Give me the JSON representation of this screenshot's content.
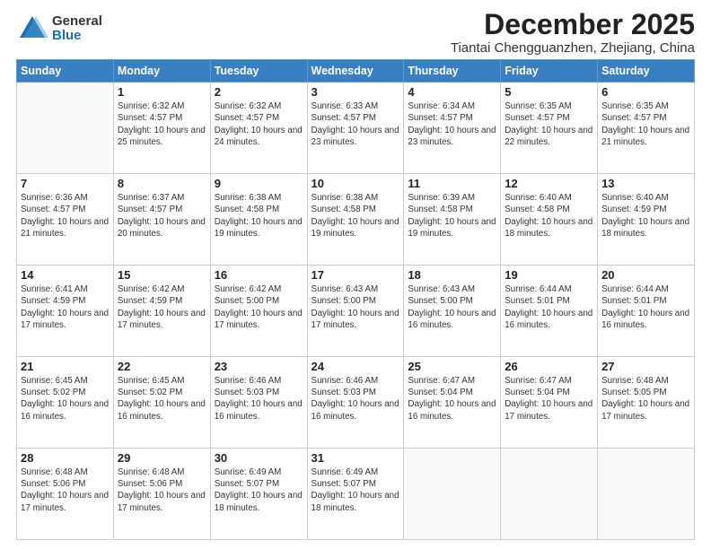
{
  "logo": {
    "general": "General",
    "blue": "Blue"
  },
  "title": "December 2025",
  "location": "Tiantai Chengguanzhen, Zhejiang, China",
  "weekdays": [
    "Sunday",
    "Monday",
    "Tuesday",
    "Wednesday",
    "Thursday",
    "Friday",
    "Saturday"
  ],
  "weeks": [
    [
      {
        "day": "",
        "info": ""
      },
      {
        "day": "1",
        "info": "Sunrise: 6:32 AM\nSunset: 4:57 PM\nDaylight: 10 hours\nand 25 minutes."
      },
      {
        "day": "2",
        "info": "Sunrise: 6:32 AM\nSunset: 4:57 PM\nDaylight: 10 hours\nand 24 minutes."
      },
      {
        "day": "3",
        "info": "Sunrise: 6:33 AM\nSunset: 4:57 PM\nDaylight: 10 hours\nand 23 minutes."
      },
      {
        "day": "4",
        "info": "Sunrise: 6:34 AM\nSunset: 4:57 PM\nDaylight: 10 hours\nand 23 minutes."
      },
      {
        "day": "5",
        "info": "Sunrise: 6:35 AM\nSunset: 4:57 PM\nDaylight: 10 hours\nand 22 minutes."
      },
      {
        "day": "6",
        "info": "Sunrise: 6:35 AM\nSunset: 4:57 PM\nDaylight: 10 hours\nand 21 minutes."
      }
    ],
    [
      {
        "day": "7",
        "info": "Sunrise: 6:36 AM\nSunset: 4:57 PM\nDaylight: 10 hours\nand 21 minutes."
      },
      {
        "day": "8",
        "info": "Sunrise: 6:37 AM\nSunset: 4:57 PM\nDaylight: 10 hours\nand 20 minutes."
      },
      {
        "day": "9",
        "info": "Sunrise: 6:38 AM\nSunset: 4:58 PM\nDaylight: 10 hours\nand 19 minutes."
      },
      {
        "day": "10",
        "info": "Sunrise: 6:38 AM\nSunset: 4:58 PM\nDaylight: 10 hours\nand 19 minutes."
      },
      {
        "day": "11",
        "info": "Sunrise: 6:39 AM\nSunset: 4:58 PM\nDaylight: 10 hours\nand 19 minutes."
      },
      {
        "day": "12",
        "info": "Sunrise: 6:40 AM\nSunset: 4:58 PM\nDaylight: 10 hours\nand 18 minutes."
      },
      {
        "day": "13",
        "info": "Sunrise: 6:40 AM\nSunset: 4:59 PM\nDaylight: 10 hours\nand 18 minutes."
      }
    ],
    [
      {
        "day": "14",
        "info": "Sunrise: 6:41 AM\nSunset: 4:59 PM\nDaylight: 10 hours\nand 17 minutes."
      },
      {
        "day": "15",
        "info": "Sunrise: 6:42 AM\nSunset: 4:59 PM\nDaylight: 10 hours\nand 17 minutes."
      },
      {
        "day": "16",
        "info": "Sunrise: 6:42 AM\nSunset: 5:00 PM\nDaylight: 10 hours\nand 17 minutes."
      },
      {
        "day": "17",
        "info": "Sunrise: 6:43 AM\nSunset: 5:00 PM\nDaylight: 10 hours\nand 17 minutes."
      },
      {
        "day": "18",
        "info": "Sunrise: 6:43 AM\nSunset: 5:00 PM\nDaylight: 10 hours\nand 16 minutes."
      },
      {
        "day": "19",
        "info": "Sunrise: 6:44 AM\nSunset: 5:01 PM\nDaylight: 10 hours\nand 16 minutes."
      },
      {
        "day": "20",
        "info": "Sunrise: 6:44 AM\nSunset: 5:01 PM\nDaylight: 10 hours\nand 16 minutes."
      }
    ],
    [
      {
        "day": "21",
        "info": "Sunrise: 6:45 AM\nSunset: 5:02 PM\nDaylight: 10 hours\nand 16 minutes."
      },
      {
        "day": "22",
        "info": "Sunrise: 6:45 AM\nSunset: 5:02 PM\nDaylight: 10 hours\nand 16 minutes."
      },
      {
        "day": "23",
        "info": "Sunrise: 6:46 AM\nSunset: 5:03 PM\nDaylight: 10 hours\nand 16 minutes."
      },
      {
        "day": "24",
        "info": "Sunrise: 6:46 AM\nSunset: 5:03 PM\nDaylight: 10 hours\nand 16 minutes."
      },
      {
        "day": "25",
        "info": "Sunrise: 6:47 AM\nSunset: 5:04 PM\nDaylight: 10 hours\nand 16 minutes."
      },
      {
        "day": "26",
        "info": "Sunrise: 6:47 AM\nSunset: 5:04 PM\nDaylight: 10 hours\nand 17 minutes."
      },
      {
        "day": "27",
        "info": "Sunrise: 6:48 AM\nSunset: 5:05 PM\nDaylight: 10 hours\nand 17 minutes."
      }
    ],
    [
      {
        "day": "28",
        "info": "Sunrise: 6:48 AM\nSunset: 5:06 PM\nDaylight: 10 hours\nand 17 minutes."
      },
      {
        "day": "29",
        "info": "Sunrise: 6:48 AM\nSunset: 5:06 PM\nDaylight: 10 hours\nand 17 minutes."
      },
      {
        "day": "30",
        "info": "Sunrise: 6:49 AM\nSunset: 5:07 PM\nDaylight: 10 hours\nand 18 minutes."
      },
      {
        "day": "31",
        "info": "Sunrise: 6:49 AM\nSunset: 5:07 PM\nDaylight: 10 hours\nand 18 minutes."
      },
      {
        "day": "",
        "info": ""
      },
      {
        "day": "",
        "info": ""
      },
      {
        "day": "",
        "info": ""
      }
    ]
  ]
}
